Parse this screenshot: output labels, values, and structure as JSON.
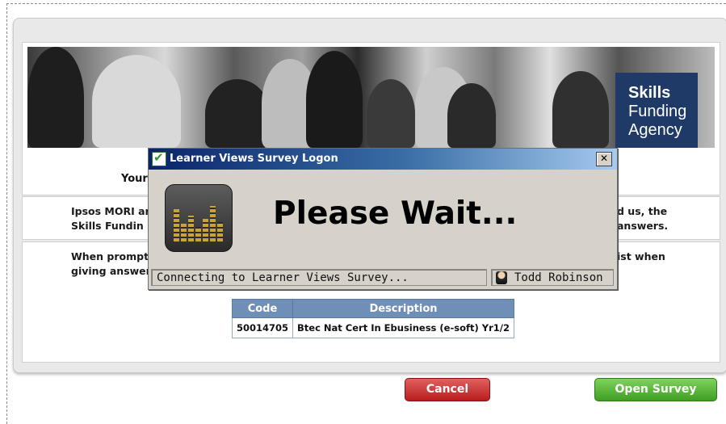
{
  "banner": {
    "logo": [
      "Skills",
      "Funding",
      "Agency"
    ]
  },
  "intro": {
    "yours_fragment": "Your"
  },
  "paragraph1": {
    "left_line1": "Ipsos MORI ar",
    "left_line2": "Skills Fundin",
    "right_line1": "d us, the",
    "right_line2": "answers."
  },
  "paragraph2": {
    "left_line1": "When prompt",
    "left_line2": "giving answer",
    "right_line1": "ist when"
  },
  "course_table": {
    "headers": [
      "Code",
      "Description"
    ],
    "rows": [
      {
        "code": "50014705",
        "description": "Btec Nat Cert In Ebusiness (e-soft) Yr1/2"
      }
    ]
  },
  "buttons": {
    "cancel": "Cancel",
    "open_survey": "Open Survey"
  },
  "dialog": {
    "title": "Learner Views Survey Logon",
    "close": "✕",
    "message": "Please Wait...",
    "status": "Connecting to Learner Views Survey...",
    "user": "Todd Robinson"
  },
  "colors": {
    "table_header": "#6f8fb6",
    "cancel": "#c62828",
    "open_survey": "#4caf30",
    "logo_bg": "#1f3a66"
  }
}
